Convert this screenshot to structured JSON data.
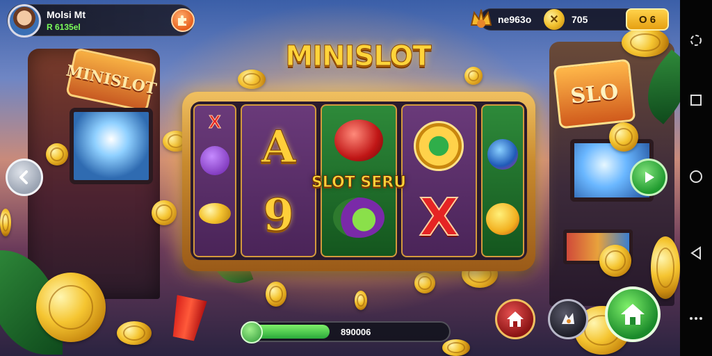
{
  "player": {
    "name": "Molsi Mt",
    "balance": "R 6135el"
  },
  "stats": {
    "gems": "ne963o",
    "coins": "705",
    "bonus": "O 6"
  },
  "logo": {
    "title": "MINISLOT"
  },
  "slot": {
    "center_label": "SLOT SERU",
    "reels": [
      {
        "color": "purple",
        "symbols": [
          "x",
          "grape",
          "coin"
        ]
      },
      {
        "color": "purple",
        "symbols": [
          "A",
          "9"
        ]
      },
      {
        "color": "green",
        "symbols": [
          "apple",
          "fruit-mix"
        ]
      },
      {
        "color": "purple",
        "symbols": [
          "compass",
          "X"
        ]
      },
      {
        "color": "green",
        "symbols": [
          "berry",
          "orange"
        ]
      }
    ],
    "symbol_text": {
      "letter_a": "A",
      "digit_9": "9",
      "x_big": "X",
      "x_small": "X"
    }
  },
  "progress": {
    "text": "890006",
    "fill_fraction": 0.42
  },
  "colors": {
    "accent_gold": "#ffd43a",
    "green": "#2aa83a",
    "red": "#e52424"
  },
  "icons": [
    "puzzle-icon",
    "crown-icon",
    "coin-icon",
    "chevron-left-icon",
    "play-icon",
    "home-icon",
    "fox-icon",
    "android-rotate-icon",
    "android-square-icon",
    "android-circle-icon",
    "android-back-icon",
    "android-more-icon"
  ]
}
